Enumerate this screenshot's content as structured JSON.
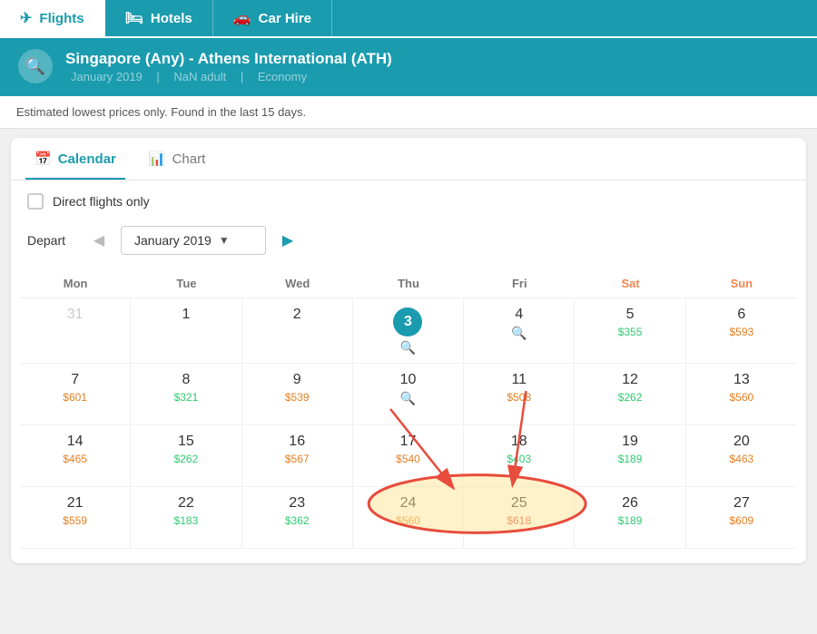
{
  "nav": {
    "tabs": [
      {
        "label": "Flights",
        "icon": "✈",
        "active": true
      },
      {
        "label": "Hotels",
        "icon": "🛏",
        "active": false
      },
      {
        "label": "Car Hire",
        "icon": "🚗",
        "active": false
      }
    ]
  },
  "search": {
    "route": "Singapore (Any) - Athens International (ATH)",
    "month": "January 2019",
    "adults": "NaN adult",
    "cabin": "Economy",
    "icon": "🔍"
  },
  "notice": "Estimated lowest prices only. Found in the last 15 days.",
  "tabs": [
    {
      "label": "Calendar",
      "icon": "📅",
      "active": true
    },
    {
      "label": "Chart",
      "icon": "📊",
      "active": false
    }
  ],
  "direct_label": "Direct flights only",
  "depart_label": "Depart",
  "month_select": "January 2019",
  "cal_headers": [
    "Mon",
    "Tue",
    "Wed",
    "Thu",
    "Fri",
    "Sat",
    "Sun"
  ],
  "calendar": [
    [
      {
        "day": "31",
        "other": true,
        "price": null,
        "color": null,
        "today": false,
        "mag": false
      },
      {
        "day": "1",
        "other": false,
        "price": null,
        "color": null,
        "today": false,
        "mag": false
      },
      {
        "day": "2",
        "other": false,
        "price": null,
        "color": null,
        "today": false,
        "mag": false
      },
      {
        "day": "3",
        "other": false,
        "price": null,
        "color": null,
        "today": true,
        "mag": true
      },
      {
        "day": "4",
        "other": false,
        "price": null,
        "color": null,
        "today": false,
        "mag": true
      },
      {
        "day": "5",
        "other": false,
        "price": "$355",
        "color": "green",
        "today": false,
        "mag": false
      },
      {
        "day": "6",
        "other": false,
        "price": "$593",
        "color": "orange",
        "today": false,
        "mag": false
      }
    ],
    [
      {
        "day": "7",
        "other": false,
        "price": "$601",
        "color": "orange",
        "today": false,
        "mag": false
      },
      {
        "day": "8",
        "other": false,
        "price": "$321",
        "color": "green",
        "today": false,
        "mag": false
      },
      {
        "day": "9",
        "other": false,
        "price": "$539",
        "color": "orange",
        "today": false,
        "mag": false
      },
      {
        "day": "10",
        "other": false,
        "price": null,
        "color": null,
        "today": false,
        "mag": true
      },
      {
        "day": "11",
        "other": false,
        "price": "$508",
        "color": "orange",
        "today": false,
        "mag": false
      },
      {
        "day": "12",
        "other": false,
        "price": "$262",
        "color": "green",
        "today": false,
        "mag": false
      },
      {
        "day": "13",
        "other": false,
        "price": "$560",
        "color": "orange",
        "today": false,
        "mag": false
      }
    ],
    [
      {
        "day": "14",
        "other": false,
        "price": "$465",
        "color": "orange",
        "today": false,
        "mag": false
      },
      {
        "day": "15",
        "other": false,
        "price": "$262",
        "color": "green",
        "today": false,
        "mag": false
      },
      {
        "day": "16",
        "other": false,
        "price": "$567",
        "color": "orange",
        "today": false,
        "mag": false
      },
      {
        "day": "17",
        "other": false,
        "price": "$540",
        "color": "orange",
        "today": false,
        "mag": false
      },
      {
        "day": "18",
        "other": false,
        "price": "$403",
        "color": "green",
        "today": false,
        "mag": false
      },
      {
        "day": "19",
        "other": false,
        "price": "$189",
        "color": "green",
        "today": false,
        "mag": false
      },
      {
        "day": "20",
        "other": false,
        "price": "$463",
        "color": "orange",
        "today": false,
        "mag": false
      }
    ],
    [
      {
        "day": "21",
        "other": false,
        "price": "$559",
        "color": "orange",
        "today": false,
        "mag": false
      },
      {
        "day": "22",
        "other": false,
        "price": "$183",
        "color": "green",
        "today": false,
        "mag": false
      },
      {
        "day": "23",
        "other": false,
        "price": "$362",
        "color": "green",
        "today": false,
        "mag": false
      },
      {
        "day": "24",
        "other": false,
        "price": "$560",
        "color": "orange",
        "today": false,
        "mag": false
      },
      {
        "day": "25",
        "other": false,
        "price": "$618",
        "color": "red",
        "today": false,
        "mag": false,
        "highlight": true
      },
      {
        "day": "26",
        "other": false,
        "price": "$189",
        "color": "green",
        "today": false,
        "mag": false,
        "highlight": true
      },
      {
        "day": "27",
        "other": false,
        "price": "$609",
        "color": "orange",
        "today": false,
        "mag": false
      }
    ]
  ]
}
